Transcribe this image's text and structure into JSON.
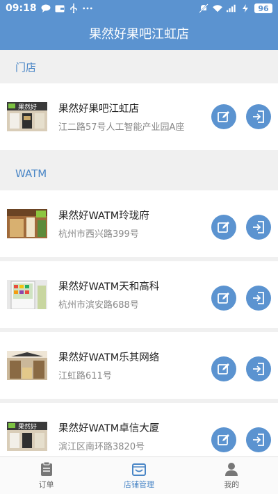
{
  "status_bar": {
    "time": "09:18",
    "battery": "96",
    "left_icons": [
      "message-icon",
      "wallet-icon",
      "usb-icon",
      "more-icon"
    ],
    "right_icons": [
      "mute-icon",
      "wifi-icon",
      "signal-icon",
      "charging-icon"
    ]
  },
  "header": {
    "title": "果然好果吧江虹店"
  },
  "sections": {
    "store": {
      "label": "门店"
    },
    "watm": {
      "label": "WATM"
    }
  },
  "store_items": [
    {
      "name": "果然好果吧江虹店",
      "address": "江二路57号人工智能产业园A座"
    }
  ],
  "watm_items": [
    {
      "name": "果然好WATM玲珑府",
      "address": "杭州市西兴路399号"
    },
    {
      "name": "果然好WATM天和高科",
      "address": "杭州市滨安路688号"
    },
    {
      "name": "果然好WATM乐其网络",
      "address": "江虹路611号"
    },
    {
      "name": "果然好WATM卓信大厦",
      "address": "滨江区南环路3820号"
    }
  ],
  "tabs": [
    {
      "label": "订单",
      "icon": "clipboard-icon"
    },
    {
      "label": "店铺管理",
      "icon": "shop-icon"
    },
    {
      "label": "我的",
      "icon": "person-icon"
    }
  ],
  "colors": {
    "primary": "#5b93d0",
    "section_text": "#4a86c6",
    "background": "#f0f0f0"
  }
}
